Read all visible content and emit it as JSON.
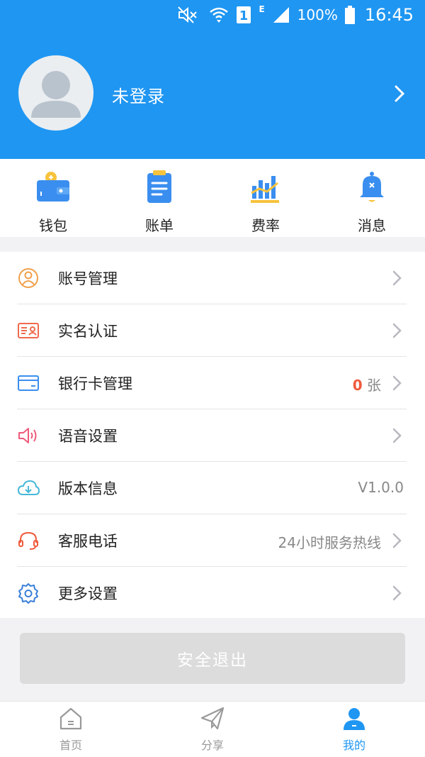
{
  "status_bar": {
    "signal_letter": "E",
    "sim_number": "1",
    "battery": "100%",
    "time": "16:45"
  },
  "profile": {
    "name": "未登录"
  },
  "quick_actions": [
    {
      "label": "钱包",
      "icon": "wallet-icon"
    },
    {
      "label": "账单",
      "icon": "bill-icon"
    },
    {
      "label": "费率",
      "icon": "rate-chart-icon"
    },
    {
      "label": "消息",
      "icon": "bell-icon"
    }
  ],
  "menu": [
    {
      "label": "账号管理",
      "icon": "user-circle-icon"
    },
    {
      "label": "实名认证",
      "icon": "id-card-icon"
    },
    {
      "label": "银行卡管理",
      "icon": "bank-card-icon",
      "count": "0",
      "unit": "张"
    },
    {
      "label": "语音设置",
      "icon": "speaker-icon"
    },
    {
      "label": "版本信息",
      "icon": "cloud-download-icon",
      "value": "V1.0.0"
    },
    {
      "label": "客服电话",
      "icon": "headset-icon",
      "value": "24小时服务热线"
    },
    {
      "label": "更多设置",
      "icon": "gear-icon"
    }
  ],
  "logout": {
    "label": "安全退出"
  },
  "bottom_nav": [
    {
      "label": "首页",
      "icon": "home-icon",
      "active": false
    },
    {
      "label": "分享",
      "icon": "paper-plane-icon",
      "active": false
    },
    {
      "label": "我的",
      "icon": "person-icon",
      "active": true
    }
  ],
  "colors": {
    "primary": "#1f96f2",
    "accent_red": "#ef5a3c",
    "logout_disabled": "#dcdcdc"
  }
}
